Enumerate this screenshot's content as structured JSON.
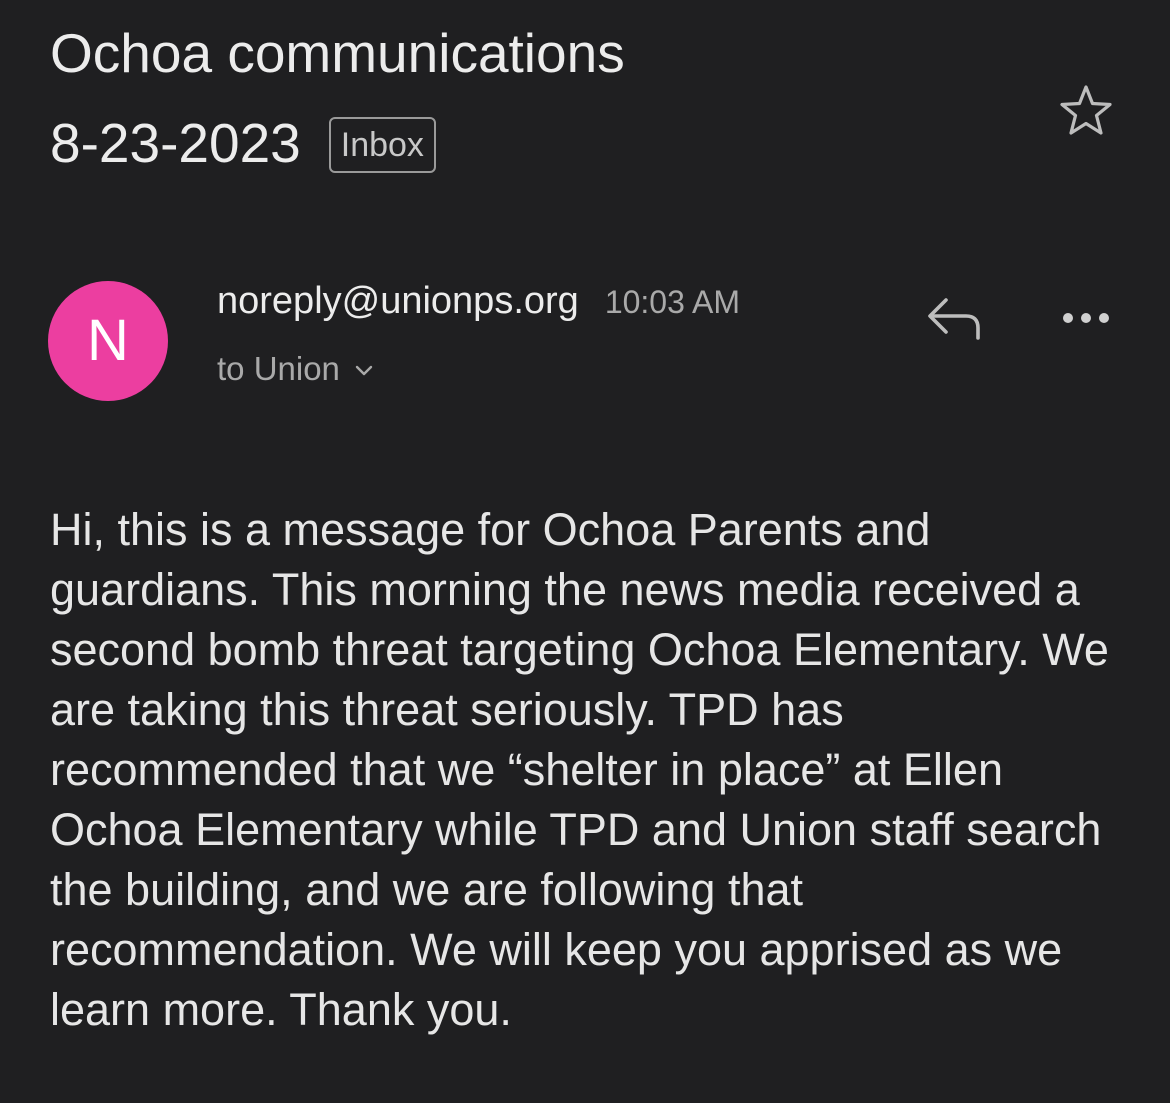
{
  "email": {
    "subject_line1": "Ochoa communications",
    "subject_line2": "8-23-2023",
    "label_badge": "Inbox",
    "sender": "noreply@unionps.org",
    "time": "10:03 AM",
    "recipient": "to Union",
    "avatar_letter": "N",
    "body": "Hi, this is a message for Ochoa Parents and guardians. This morning the news media received a second bomb threat targeting Ochoa Elementary. We are taking this threat seriously. TPD has recommended that we “shelter in place” at Ellen Ochoa Elementary while TPD and Union staff search the building, and we are following that recommendation. We will keep you apprised as we learn more. Thank you."
  },
  "icons": {
    "star": "star-outline-icon",
    "reply": "reply-icon",
    "more": "more-horizontal-icon",
    "expand": "chevron-down-icon"
  },
  "colors": {
    "background": "#1f1f21",
    "avatar": "#ec3ea0",
    "text_primary": "#ececec",
    "text_secondary": "#a9a9a9"
  }
}
